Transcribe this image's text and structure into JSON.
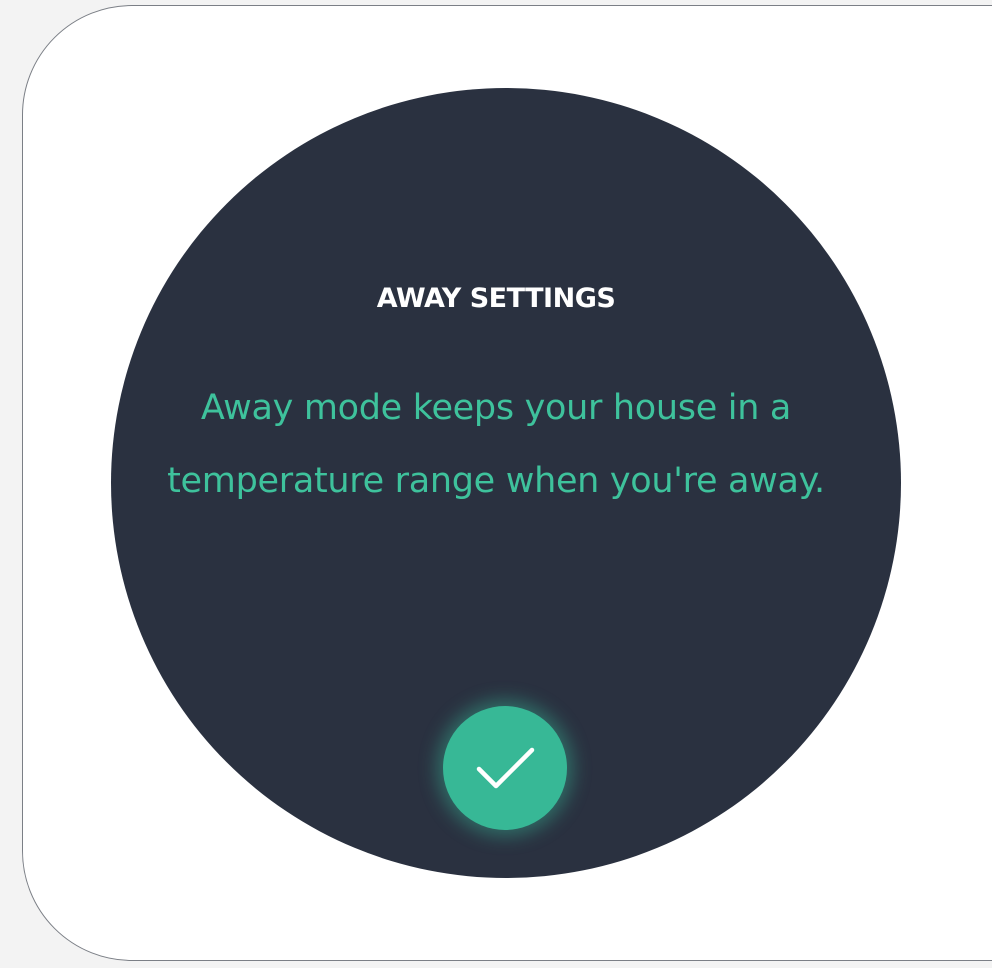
{
  "away_settings": {
    "title": "AWAY SETTINGS",
    "message_line_1": "Away mode keeps your house in a",
    "message_line_2": "temperature range when you're away.",
    "confirm_icon": "checkmark-icon"
  },
  "colors": {
    "face_background": "#2a3140",
    "accent": "#37b896",
    "message_text": "#3ec29c",
    "title_text": "#ffffff"
  }
}
